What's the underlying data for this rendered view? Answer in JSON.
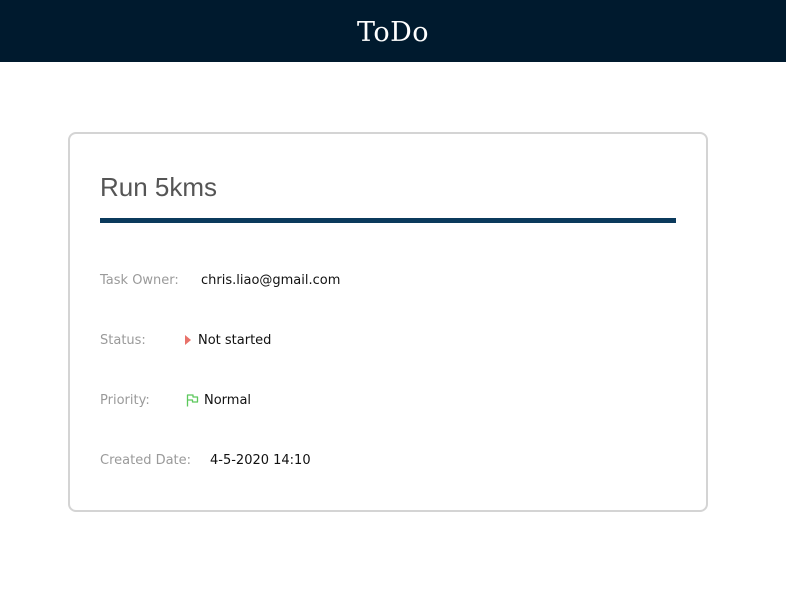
{
  "header": {
    "title": "ToDo",
    "background": "#001a2e"
  },
  "task": {
    "title": "Run 5kms",
    "accent_color": "#0b3a5c",
    "fields": {
      "owner": {
        "label": "Task Owner:",
        "value": "chris.liao@gmail.com"
      },
      "status": {
        "label": "Status:",
        "value": "Not started",
        "icon": "play-triangle-icon",
        "icon_color": "#e8726a"
      },
      "priority": {
        "label": "Priority:",
        "value": "Normal",
        "icon": "flag-icon",
        "icon_color": "#5cc85c"
      },
      "created": {
        "label": "Created Date:",
        "value": "4-5-2020 14:10"
      }
    }
  }
}
